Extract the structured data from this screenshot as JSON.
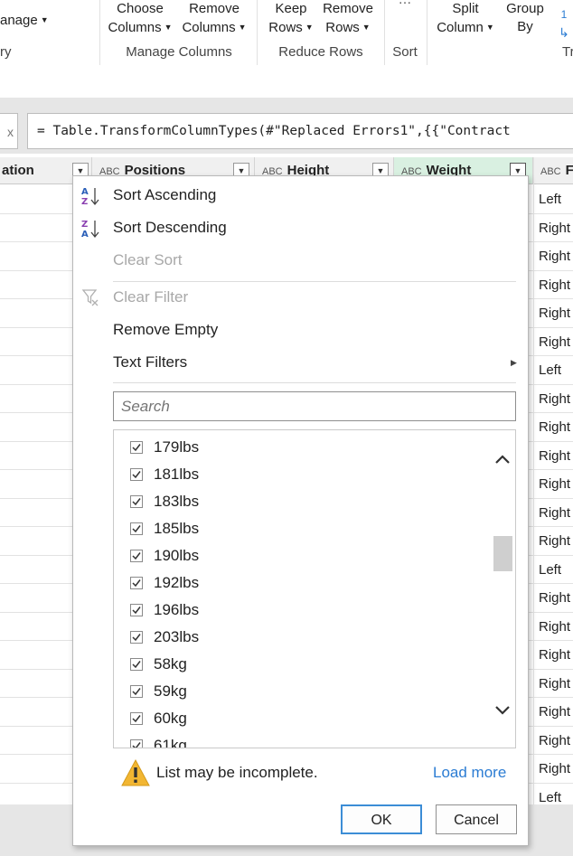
{
  "ribbon": {
    "manage": "anage",
    "query_group": "ry",
    "choose_columns_1": "Choose",
    "choose_columns_2": "Columns",
    "remove_columns_1": "Remove",
    "remove_columns_2": "Columns",
    "manage_columns_group": "Manage Columns",
    "keep_rows_1": "Keep",
    "keep_rows_2": "Rows",
    "remove_rows_1": "Remove",
    "remove_rows_2": "Rows",
    "reduce_rows_group": "Reduce Rows",
    "sort_group": "Sort",
    "split_column_1": "Split",
    "split_column_2": "Column",
    "group_by_1": "Group",
    "group_by_2": "By",
    "transform_group": "Tr"
  },
  "formula_bar": {
    "fx": "x",
    "text": "= Table.TransformColumnTypes(#\"Replaced Errors1\",{{\"Contract"
  },
  "columns": {
    "col1": "ation",
    "col2_type": "ABC",
    "col2": "Positions",
    "col3_type": "ABC",
    "col3": "Height",
    "col4_type": "ABC",
    "col4": "Weight",
    "col5_type": "ABC",
    "col5": "F"
  },
  "right_column_values": [
    "Left",
    "Right",
    "Right",
    "Right",
    "Right",
    "Right",
    "Left",
    "Right",
    "Right",
    "Right",
    "Right",
    "Right",
    "Right",
    "Left",
    "Right",
    "Right",
    "Right",
    "Right",
    "Right",
    "Right",
    "Right",
    "Left"
  ],
  "filter_menu": {
    "sort_ascending": "Sort Ascending",
    "sort_descending": "Sort Descending",
    "clear_sort": "Clear Sort",
    "clear_filter": "Clear Filter",
    "remove_empty": "Remove Empty",
    "text_filters": "Text Filters",
    "search_placeholder": "Search",
    "items": [
      {
        "label": "179lbs",
        "checked": true
      },
      {
        "label": "181lbs",
        "checked": true
      },
      {
        "label": "183lbs",
        "checked": true
      },
      {
        "label": "185lbs",
        "checked": true
      },
      {
        "label": "190lbs",
        "checked": true
      },
      {
        "label": "192lbs",
        "checked": true
      },
      {
        "label": "196lbs",
        "checked": true
      },
      {
        "label": "203lbs",
        "checked": true
      },
      {
        "label": "58kg",
        "checked": true
      },
      {
        "label": "59kg",
        "checked": true
      },
      {
        "label": "60kg",
        "checked": true
      },
      {
        "label": "61kg",
        "checked": true
      }
    ],
    "warning": "List may be incomplete.",
    "load_more": "Load more",
    "ok": "OK",
    "cancel": "Cancel"
  },
  "colors": {
    "accent_blue": "#2b7cd3",
    "active_header": "#d9f0e1",
    "warning_yellow": "#f2b632"
  }
}
